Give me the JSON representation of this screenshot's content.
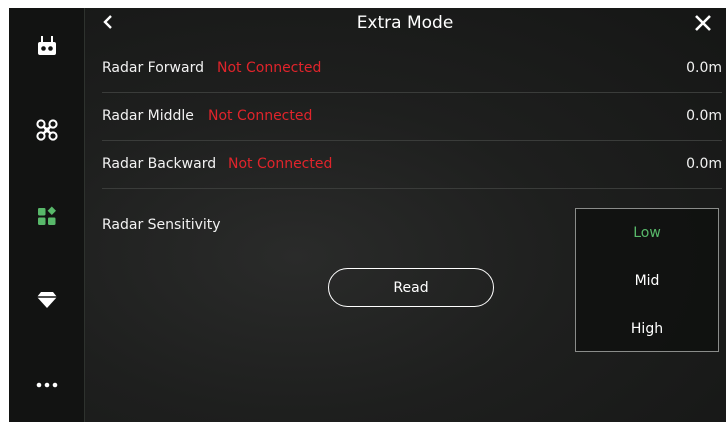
{
  "header": {
    "title": "Extra Mode",
    "back_icon": "chevron-left-icon",
    "close_icon": "close-icon"
  },
  "sidebar": {
    "items": [
      {
        "name": "remote-controller",
        "icon": "remote-controller-icon"
      },
      {
        "name": "aircraft",
        "icon": "drone-icon"
      },
      {
        "name": "apps",
        "icon": "apps-grid-icon",
        "active": true
      },
      {
        "name": "gem",
        "icon": "diamond-icon"
      },
      {
        "name": "more",
        "icon": "more-icon"
      }
    ]
  },
  "radars": [
    {
      "label": "Radar Forward",
      "status": "Not Connected",
      "value": "0.0m"
    },
    {
      "label": "Radar Middle",
      "status": "Not Connected",
      "value": "0.0m"
    },
    {
      "label": "Radar Backward",
      "status": "Not Connected",
      "value": "0.0m"
    }
  ],
  "sensitivity": {
    "label": "Radar Sensitivity",
    "options": [
      "Low",
      "Mid",
      "High"
    ],
    "selected": "Low"
  },
  "read_button": "Read",
  "colors": {
    "accent": "#58b86a",
    "error": "#e0242b",
    "background": "#1e1f1e"
  }
}
